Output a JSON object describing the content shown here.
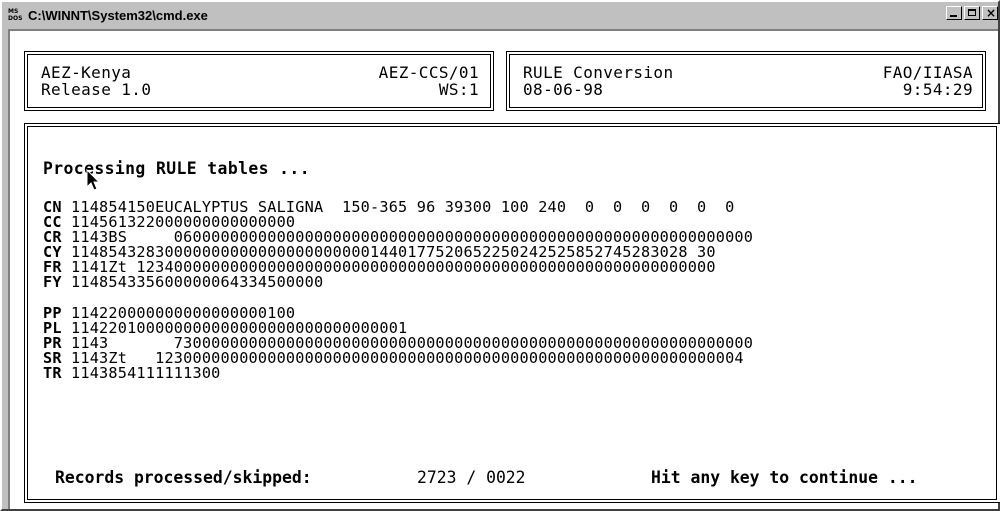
{
  "window": {
    "title": "C:\\WINNT\\System32\\cmd.exe",
    "icon_text": "MS DOS"
  },
  "header": {
    "left": {
      "app": "AEZ-Kenya",
      "code": "AEZ-CCS/01",
      "release": "Release 1.0",
      "ws": "WS:1"
    },
    "right": {
      "task": "RULE Conversion",
      "org": "FAO/IIASA",
      "date": "08-06-98",
      "time": "9:54:29"
    }
  },
  "main": {
    "processing_text": "Processing RULE tables ...",
    "records_group1": [
      {
        "code": "CN",
        "data": " 114854150EUCALYPTUS SALIGNA  150-365 96 39300 100 240  0  0  0  0  0  0"
      },
      {
        "code": "CC",
        "data": " 114561322000000000000000"
      },
      {
        "code": "CR",
        "data": " 1143BS     06000000000000000000000000000000000000000000000000000000000000"
      },
      {
        "code": "CY",
        "data": " 114854328300000000000000000000001440177520652250242525852745283028 30"
      },
      {
        "code": "FR",
        "data": " 1141Zt 12340000000000000000000000000000000000000000000000000000000000"
      },
      {
        "code": "FY",
        "data": " 114854335600000064334500000"
      }
    ],
    "records_group2": [
      {
        "code": "PP",
        "data": " 114220000000000000000100"
      },
      {
        "code": "PL",
        "data": " 114220100000000000000000000000000001"
      },
      {
        "code": "PR",
        "data": " 1143       73000000000000000000000000000000000000000000000000000000000000"
      },
      {
        "code": "SR",
        "data": " 1143Zt   123000000000000000000000000000000000000000000000000000000000004"
      },
      {
        "code": "TR",
        "data": " 1143854111111300"
      }
    ],
    "status_label": "Records processed/skipped:",
    "status_value": "2723 / 0022",
    "continue_prompt": "Hit any key to continue ..."
  }
}
